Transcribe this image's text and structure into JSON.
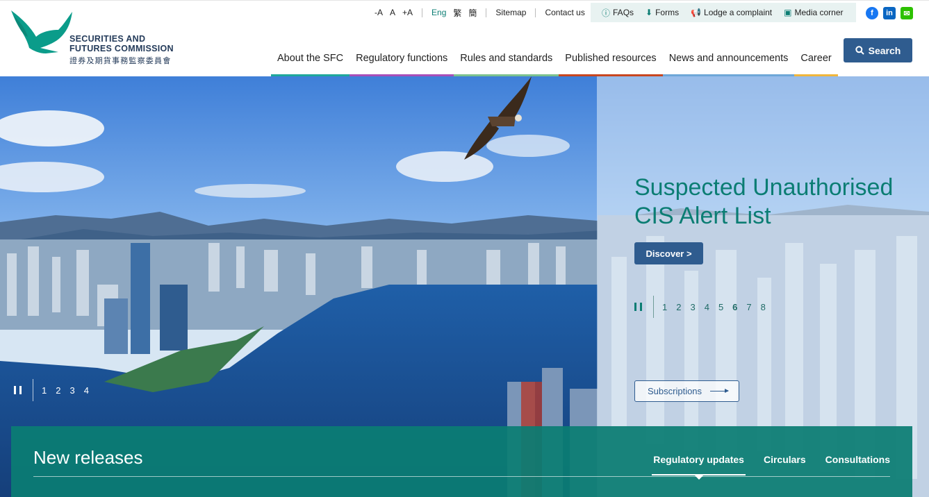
{
  "logo": {
    "name_en_line1": "SECURITIES AND",
    "name_en_line2": "FUTURES COMMISSION",
    "name_zh": "證券及期貨事務監察委員會",
    "color": "#0b9c8a"
  },
  "utility": {
    "font_small": "-A",
    "font_normal": "A",
    "font_large": "+A",
    "lang_eng": "Eng",
    "lang_tc": "繁",
    "lang_sc": "簡",
    "sitemap": "Sitemap",
    "contact": "Contact us",
    "faqs": "FAQs",
    "forms": "Forms",
    "complaint": "Lodge a complaint",
    "media": "Media corner"
  },
  "social": [
    {
      "name": "facebook-icon",
      "glyph": "f",
      "color": "#1877f2"
    },
    {
      "name": "linkedin-icon",
      "glyph": "in",
      "color": "#0a66c2"
    },
    {
      "name": "wechat-icon",
      "glyph": "✉",
      "color": "#2dc100"
    }
  ],
  "nav": [
    {
      "label": "About the SFC",
      "color": "#1fa89c"
    },
    {
      "label": "Regulatory functions",
      "color": "#a84fb8"
    },
    {
      "label": "Rules and standards",
      "color": "#7cc28f"
    },
    {
      "label": "Published resources",
      "color": "#c8461f"
    },
    {
      "label": "News and announcements",
      "color": "#6ea7d8"
    },
    {
      "label": "Career",
      "color": "#f0b63c"
    }
  ],
  "search_label": "Search",
  "hero": {
    "title_line1": "Suspected Unauthorised",
    "title_line2": "CIS Alert List",
    "discover_label": "Discover >",
    "subscriptions_label": "Subscriptions",
    "pager_right": [
      "1",
      "2",
      "3",
      "4",
      "5",
      "6",
      "7",
      "8"
    ],
    "pager_right_active": "6",
    "pager_left": [
      "1",
      "2",
      "3",
      "4"
    ]
  },
  "releases": {
    "title": "New releases",
    "tabs": [
      "Regulatory updates",
      "Circulars",
      "Consultations"
    ],
    "active_tab": "Regulatory updates"
  }
}
